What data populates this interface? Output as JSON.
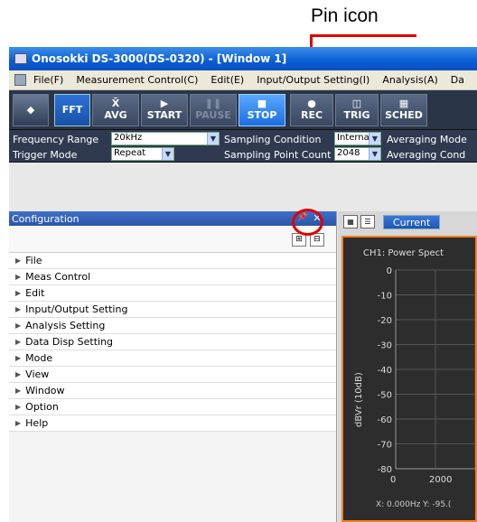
{
  "callout": {
    "text": "Pin icon"
  },
  "window": {
    "title": "Onosokki DS-3000(DS-0320) - [Window 1]"
  },
  "menu": [
    "File(F)",
    "Measurement Control(C)",
    "Edit(E)",
    "Input/Output Setting(I)",
    "Analysis(A)",
    "Da"
  ],
  "toolbar": {
    "fft": "FFT",
    "avg": "AVG",
    "avg_sym": "X̄",
    "start": "START",
    "start_sym": "▶",
    "pause": "PAUSE",
    "pause_sym": "❚❚",
    "stop": "STOP",
    "stop_sym": "■",
    "rec": "REC",
    "rec_sym": "●",
    "trig": "TRIG",
    "trig_sym": "◫",
    "sched": "SCHED",
    "sched_sym": "▦"
  },
  "settings": {
    "freq_label": "Frequency Range",
    "freq_value": "20kHz",
    "sampling_cond_label": "Sampling Condition",
    "sampling_cond_value": "Internal",
    "avg_mode_label": "Averaging Mode",
    "trigger_label": "Trigger Mode",
    "trigger_value": "Repeat",
    "sampling_count_label": "Sampling Point Count",
    "sampling_count_value": "2048",
    "avg_cond_label": "Averaging Cond"
  },
  "config": {
    "title": "Configuration",
    "items": [
      "File",
      "Meas Control",
      "Edit",
      "Input/Output Setting",
      "Analysis Setting",
      "Data Disp Setting",
      "Mode",
      "View",
      "Window",
      "Option",
      "Help"
    ]
  },
  "graph": {
    "tab": "Current",
    "channel_title": "CH1: Power Spect",
    "ylabel": "dBVr (10dB)",
    "yticks": [
      "0",
      "-10",
      "-20",
      "-30",
      "-40",
      "-50",
      "-60",
      "-70",
      "-80"
    ],
    "xticks": [
      "0",
      "2000"
    ],
    "readout": "X: 0.000Hz  Y: -95.("
  },
  "colors": {
    "accent": "#e00000",
    "graph_border": "#f08020",
    "title_blue": "#0a5dd4"
  }
}
